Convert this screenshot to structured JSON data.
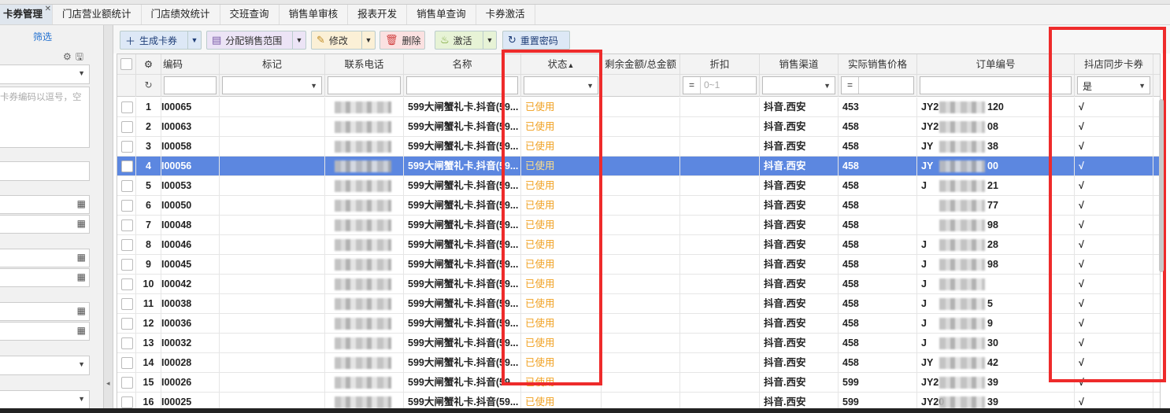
{
  "tabs": [
    "卡券管理",
    "门店营业额统计",
    "门店绩效统计",
    "交班查询",
    "销售单审核",
    "报表开发",
    "销售单查询",
    "卡券激活"
  ],
  "sidebar": {
    "filter_label": "筛选",
    "code_placeholder": "卡券编码以逗号，空"
  },
  "toolbar": {
    "generate": "生成卡券",
    "assign": "分配销售范围",
    "edit": "修改",
    "delete": "删除",
    "activate": "激活",
    "reset": "重置密码"
  },
  "columns": {
    "code": "编码",
    "mark": "标记",
    "phone": "联系电话",
    "name": "名称",
    "status": "状态",
    "balance": "剩余金额/总金额",
    "discount": "折扣",
    "channel": "销售渠道",
    "price": "实际销售价格",
    "order": "订单编号",
    "sync": "抖店同步卡券"
  },
  "filters": {
    "discount_placeholder": "0~1",
    "sync_value": "是",
    "eq": "="
  },
  "rows": [
    {
      "num": "1",
      "code": "I00065",
      "name": "599大闸蟹礼卡.抖音(59...",
      "status": "已使用",
      "channel": "抖音.西安",
      "price": "453",
      "order": "JY2",
      "order_tail": "120",
      "sync": "√"
    },
    {
      "num": "2",
      "code": "I00063",
      "name": "599大闸蟹礼卡.抖音(59...",
      "status": "已使用",
      "channel": "抖音.西安",
      "price": "458",
      "order": "JY2",
      "order_tail": "08",
      "sync": "√"
    },
    {
      "num": "3",
      "code": "I00058",
      "name": "599大闸蟹礼卡.抖音(59...",
      "status": "已使用",
      "channel": "抖音.西安",
      "price": "458",
      "order": "JY",
      "order_tail": "38",
      "sync": "√"
    },
    {
      "num": "4",
      "code": "I00056",
      "name": "599大闸蟹礼卡.抖音(59...",
      "status": "已使用",
      "channel": "抖音.西安",
      "price": "458",
      "order": "JY",
      "order_tail": "00",
      "sync": "√"
    },
    {
      "num": "5",
      "code": "I00053",
      "name": "599大闸蟹礼卡.抖音(59...",
      "status": "已使用",
      "channel": "抖音.西安",
      "price": "458",
      "order": "J",
      "order_tail": "21",
      "sync": "√"
    },
    {
      "num": "6",
      "code": "I00050",
      "name": "599大闸蟹礼卡.抖音(59...",
      "status": "已使用",
      "channel": "抖音.西安",
      "price": "458",
      "order": "",
      "order_tail": "77",
      "sync": "√"
    },
    {
      "num": "7",
      "code": "I00048",
      "name": "599大闸蟹礼卡.抖音(59...",
      "status": "已使用",
      "channel": "抖音.西安",
      "price": "458",
      "order": "",
      "order_tail": "98",
      "sync": "√"
    },
    {
      "num": "8",
      "code": "I00046",
      "name": "599大闸蟹礼卡.抖音(59...",
      "status": "已使用",
      "channel": "抖音.西安",
      "price": "458",
      "order": "J",
      "order_tail": "28",
      "sync": "√"
    },
    {
      "num": "9",
      "code": "I00045",
      "name": "599大闸蟹礼卡.抖音(59...",
      "status": "已使用",
      "channel": "抖音.西安",
      "price": "458",
      "order": "J",
      "order_tail": "98",
      "sync": "√"
    },
    {
      "num": "10",
      "code": "I00042",
      "name": "599大闸蟹礼卡.抖音(59...",
      "status": "已使用",
      "channel": "抖音.西安",
      "price": "458",
      "order": "J",
      "order_tail": "",
      "sync": "√"
    },
    {
      "num": "11",
      "code": "I00038",
      "name": "599大闸蟹礼卡.抖音(59...",
      "status": "已使用",
      "channel": "抖音.西安",
      "price": "458",
      "order": "J",
      "order_tail": "5",
      "sync": "√"
    },
    {
      "num": "12",
      "code": "I00036",
      "name": "599大闸蟹礼卡.抖音(59...",
      "status": "已使用",
      "channel": "抖音.西安",
      "price": "458",
      "order": "J",
      "order_tail": "9",
      "sync": "√"
    },
    {
      "num": "13",
      "code": "I00032",
      "name": "599大闸蟹礼卡.抖音(59...",
      "status": "已使用",
      "channel": "抖音.西安",
      "price": "458",
      "order": "J",
      "order_tail": "30",
      "sync": "√"
    },
    {
      "num": "14",
      "code": "I00028",
      "name": "599大闸蟹礼卡.抖音(59...",
      "status": "已使用",
      "channel": "抖音.西安",
      "price": "458",
      "order": "JY",
      "order_tail": "42",
      "sync": "√"
    },
    {
      "num": "15",
      "code": "I00026",
      "name": "599大闸蟹礼卡.抖音(59...",
      "status": "已使用",
      "channel": "抖音.西安",
      "price": "599",
      "order": "JY2",
      "order_tail": "39",
      "sync": "√"
    },
    {
      "num": "16",
      "code": "I00025",
      "name": "599大闸蟹礼卡.抖音(59...",
      "status": "已使用",
      "channel": "抖音.西安",
      "price": "599",
      "order": "JY20",
      "order_tail": "39",
      "sync": "√"
    }
  ],
  "colors": {
    "selected_row": "#5c87e0",
    "status_used": "#f0a020",
    "highlight": "#ee2b2b",
    "accent": "#1f6fd0"
  }
}
